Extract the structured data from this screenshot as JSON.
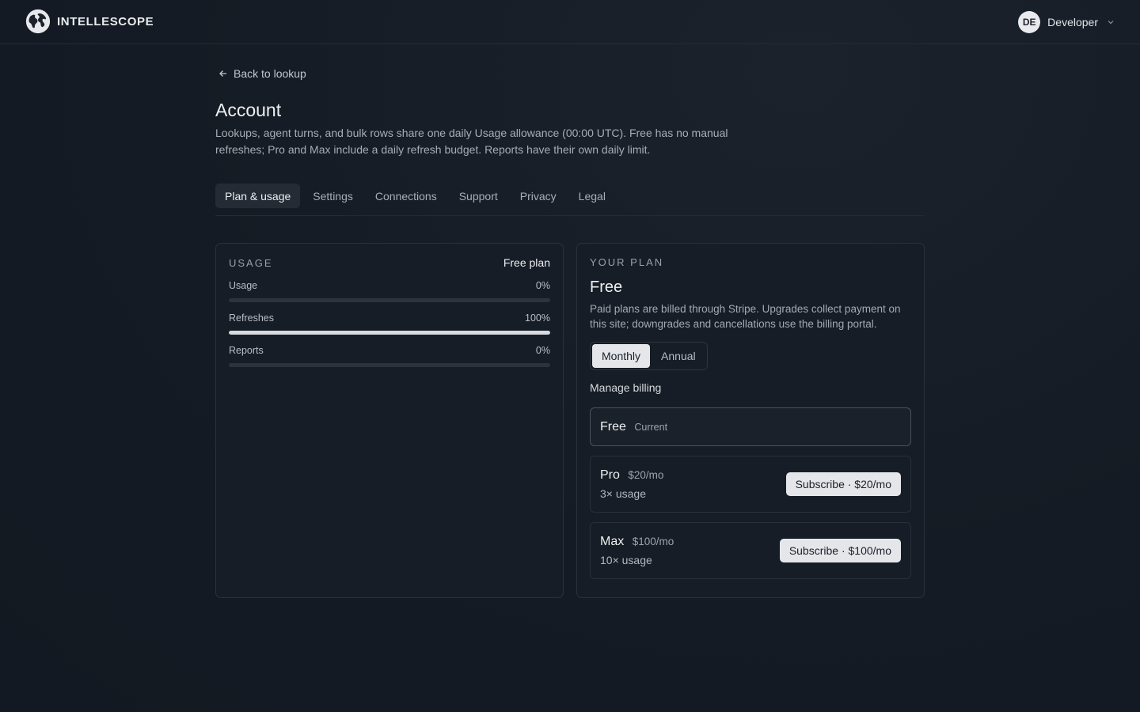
{
  "brand": {
    "name": "INTELLESCOPE"
  },
  "user": {
    "initials": "DE",
    "name": "Developer"
  },
  "nav": {
    "back_label": "Back to lookup"
  },
  "page": {
    "title": "Account",
    "description": "Lookups, agent turns, and bulk rows share one daily Usage allowance (00:00 UTC). Free has no manual refreshes; Pro and Max include a daily refresh budget. Reports have their own daily limit."
  },
  "tabs": [
    {
      "label": "Plan & usage",
      "active": true
    },
    {
      "label": "Settings"
    },
    {
      "label": "Connections"
    },
    {
      "label": "Support"
    },
    {
      "label": "Privacy"
    },
    {
      "label": "Legal"
    }
  ],
  "usage": {
    "heading": "USAGE",
    "plan_tag": "Free plan",
    "meters": [
      {
        "label": "Usage",
        "value_text": "0%",
        "fraction": 0
      },
      {
        "label": "Refreshes",
        "value_text": "100%",
        "fraction": 1
      },
      {
        "label": "Reports",
        "value_text": "0%",
        "fraction": 0
      }
    ]
  },
  "plan": {
    "heading": "YOUR PLAN",
    "name": "Free",
    "description": "Paid plans are billed through Stripe. Upgrades collect payment on this site; downgrades and cancellations use the billing portal.",
    "cycle": {
      "monthly": "Monthly",
      "annual": "Annual",
      "selected": "monthly"
    },
    "manage_billing": "Manage billing",
    "tiers": [
      {
        "name": "Free",
        "badge": "Current"
      },
      {
        "name": "Pro",
        "price": "$20/mo",
        "detail": "3× usage",
        "button": "Subscribe · $20/mo"
      },
      {
        "name": "Max",
        "price": "$100/mo",
        "detail": "10× usage",
        "button": "Subscribe · $100/mo"
      }
    ]
  },
  "colors": {
    "background": "#151b24",
    "card": "#171d26",
    "accent": "#e4e6ea"
  }
}
